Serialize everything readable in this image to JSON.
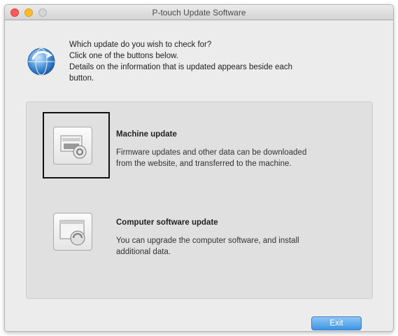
{
  "window": {
    "title": "P-touch Update Software"
  },
  "header": {
    "icon": "update-globe-icon",
    "lines": [
      "Which update do you wish to check for?",
      "Click one of the buttons below.",
      "Details on the information that is updated appears beside each",
      "button."
    ]
  },
  "options": [
    {
      "title": "Machine update",
      "icon": "machine-update-icon",
      "desc": [
        "Firmware updates and other data can be downloaded",
        "from the website, and transferred to the machine."
      ],
      "highlighted": true
    },
    {
      "title": "Computer software update",
      "icon": "computer-software-update-icon",
      "desc": [
        "You can upgrade the computer software, and install",
        "additional data."
      ],
      "highlighted": false
    }
  ],
  "footer": {
    "exit_label": "Exit"
  },
  "colors": {
    "accent": "#3c95e6",
    "highlight_box": "#111111"
  }
}
